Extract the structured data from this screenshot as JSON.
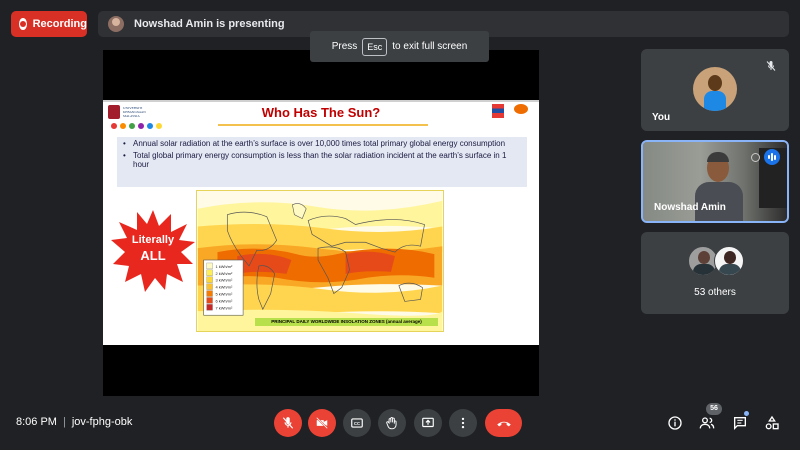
{
  "recording": {
    "label": "Recording"
  },
  "presenting": {
    "text": "Nowshad Amin is presenting"
  },
  "esc_hint": {
    "prefix": "Press",
    "key": "Esc",
    "suffix": "to exit full screen"
  },
  "slide": {
    "title": "Who Has The Sun?",
    "bullets": [
      "Annual solar radiation at the earth’s surface is over 10,000 times total primary global energy consumption",
      "Total global primary energy consumption is less than the solar radiation incident at the earth’s surface in 1 hour"
    ],
    "burst_line1": "Literally",
    "burst_line2": "ALL",
    "map_caption": "PRINCIPAL DAILY WORLDWIDE INSOLATION ZONES (annual average)",
    "legend": [
      "1 kWh/m²",
      "2 kWh/m²",
      "3 kWh/m²",
      "4 kWh/m²",
      "5 kWh/m²",
      "6 kWh/m²",
      "7 kWh/m²"
    ],
    "legend_colors": [
      "#fff9c4",
      "#ffee58",
      "#fdd835",
      "#fbc02d",
      "#f57c00",
      "#e64a19",
      "#c62828"
    ]
  },
  "participants": {
    "you": {
      "name": "You"
    },
    "presenter": {
      "name": "Nowshad Amin"
    },
    "others": {
      "label": "53 others"
    }
  },
  "footer": {
    "time": "8:06 PM",
    "meeting_code": "jov-fphg-obk",
    "people_count": "56"
  },
  "colors": {
    "recording": "#d93025",
    "control_red": "#ea4335",
    "highlight_border": "#8ab4f8",
    "accent_blue": "#1a73e8"
  }
}
